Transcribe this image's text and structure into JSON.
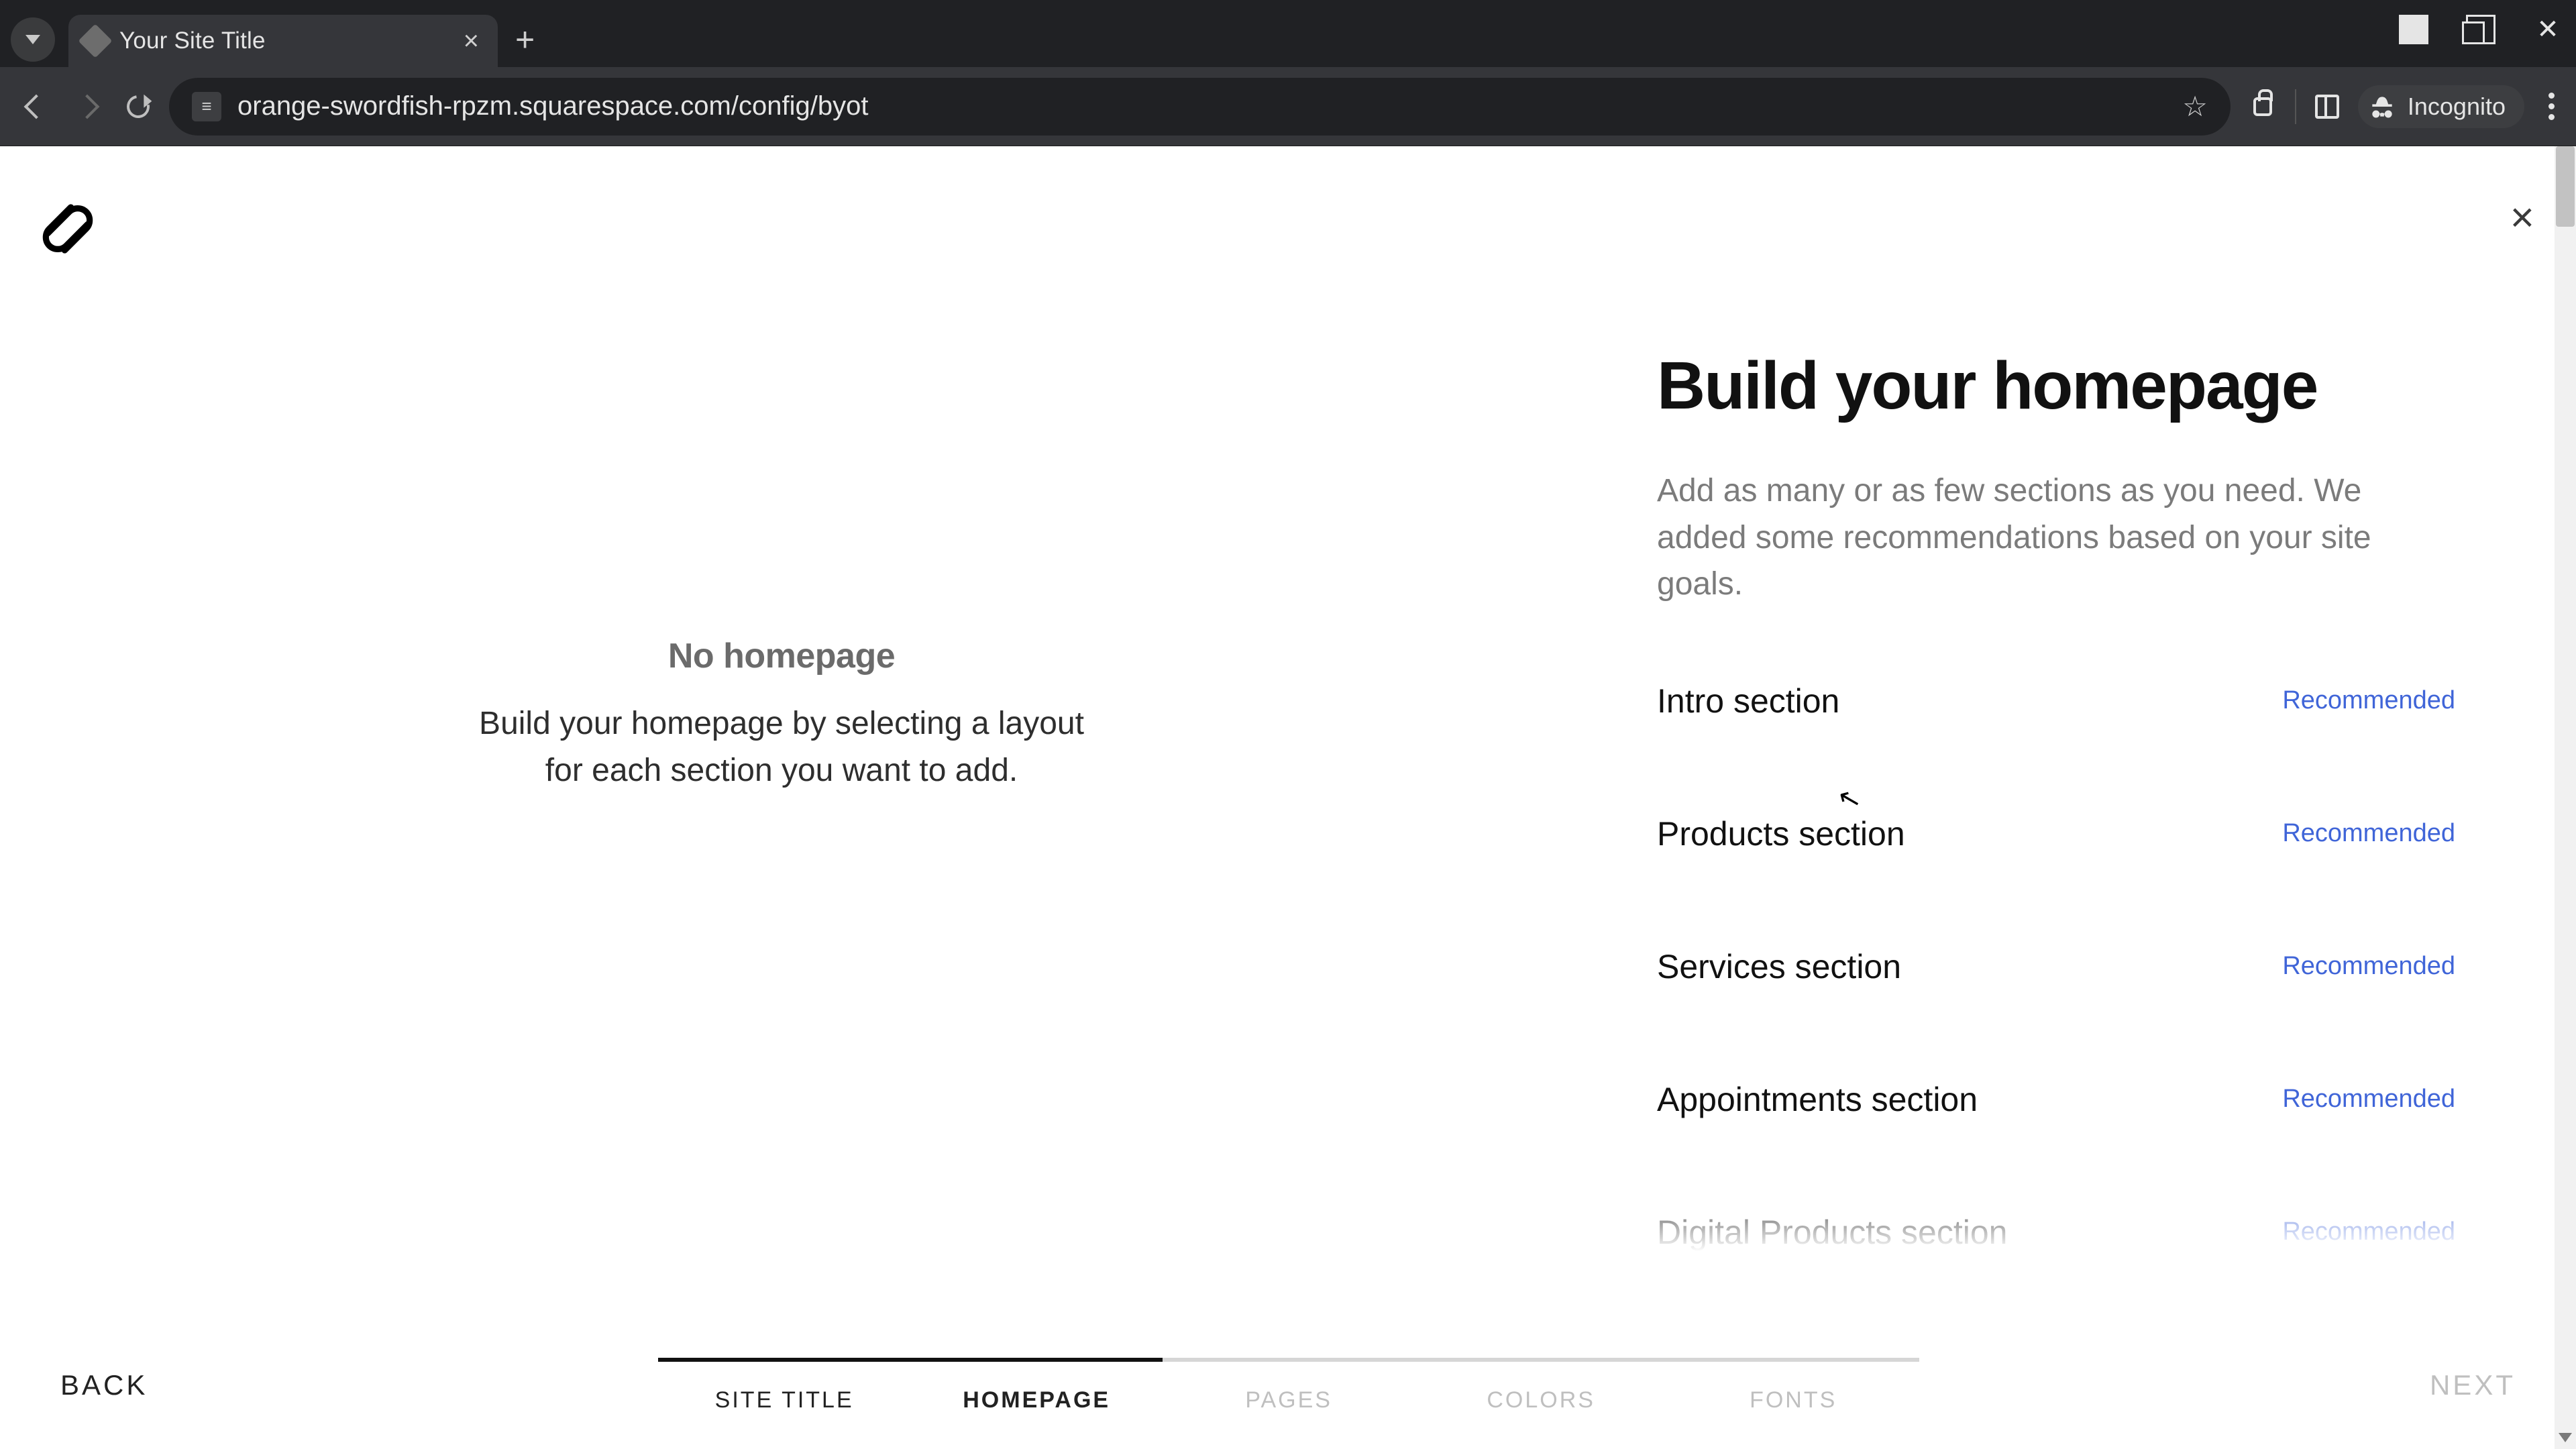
{
  "browser": {
    "tab_title": "Your Site Title",
    "url": "orange-swordfish-rpzm.squarespace.com/config/byot",
    "incognito_label": "Incognito"
  },
  "page": {
    "left": {
      "title": "No homepage",
      "description": "Build your homepage by selecting a layout for each section you want to add."
    },
    "right": {
      "heading": "Build your homepage",
      "subheading": "Add as many or as few sections as you need. We added some recommendations based on your site goals.",
      "recommended_label": "Recommended",
      "sections": [
        {
          "name": "Intro section",
          "recommended": true
        },
        {
          "name": "Products section",
          "recommended": true
        },
        {
          "name": "Services section",
          "recommended": true
        },
        {
          "name": "Appointments section",
          "recommended": true
        },
        {
          "name": "Digital Products section",
          "recommended": true
        }
      ]
    }
  },
  "footer": {
    "back": "BACK",
    "next": "NEXT",
    "steps": [
      {
        "label": "SITE TITLE",
        "state": "done"
      },
      {
        "label": "HOMEPAGE",
        "state": "active"
      },
      {
        "label": "PAGES",
        "state": "upcoming"
      },
      {
        "label": "COLORS",
        "state": "upcoming"
      },
      {
        "label": "FONTS",
        "state": "upcoming"
      }
    ]
  }
}
